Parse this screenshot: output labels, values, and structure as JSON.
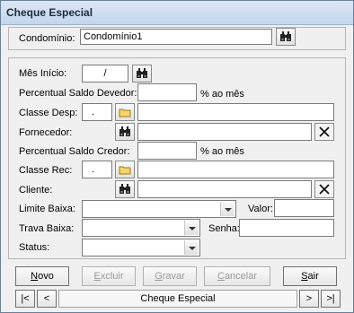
{
  "window": {
    "title": "Cheque Especial"
  },
  "header": {
    "condominio_label": "Condomínio:",
    "condominio_value": "Condomínio1"
  },
  "form": {
    "mes_inicio_label": "Mês Início:",
    "mes_inicio_value": "/",
    "perc_saldo_devedor_label": "Percentual Saldo Devedor:",
    "perc_saldo_devedor_value": "",
    "ao_mes_1": "% ao mês",
    "classe_desp_label": "Classe Desp:",
    "classe_desp_code": ".",
    "classe_desp_desc": "",
    "fornecedor_label": "Fornecedor:",
    "fornecedor_value": "",
    "perc_saldo_credor_label": "Percentual Saldo Credor:",
    "perc_saldo_credor_value": "",
    "ao_mes_2": "% ao mês",
    "classe_rec_label": "Classe Rec:",
    "classe_rec_code": ".",
    "classe_rec_desc": "",
    "cliente_label": "Cliente:",
    "cliente_value": "",
    "limite_baixa_label": "Limite Baixa:",
    "limite_baixa_value": "",
    "valor_label": "Valor:",
    "valor_value": "",
    "trava_baixa_label": "Trava Baixa:",
    "trava_baixa_value": "",
    "senha_label": "Senha:",
    "senha_value": "",
    "status_label": "Status:",
    "status_value": ""
  },
  "actions": {
    "novo_rest": "ovo",
    "novo_key": "N",
    "excluir_rest": "xcluir",
    "excluir_key": "E",
    "gravar_rest": "ravar",
    "gravar_key": "G",
    "cancelar_rest": "ancelar",
    "cancelar_key": "C",
    "sair_rest": "air",
    "sair_key": "S"
  },
  "nav": {
    "first": "|<",
    "prev": "<",
    "label": "Cheque Especial",
    "next": ">",
    "last": ">|"
  },
  "icons": {
    "search": "binoculars-icon",
    "folder": "folder-icon",
    "clear": "x-icon"
  }
}
